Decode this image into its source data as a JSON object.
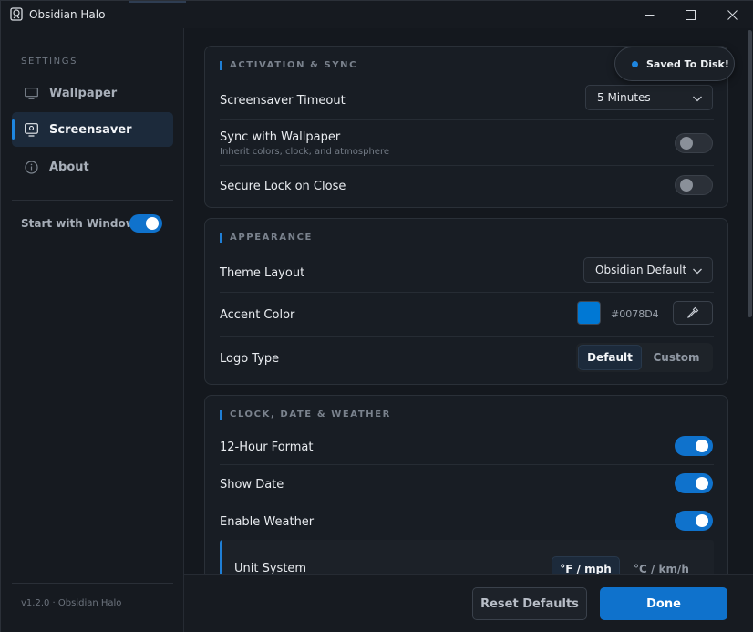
{
  "window": {
    "title": "Obsidian Halo",
    "controls": {
      "minimize": "minimize-icon",
      "maximize": "maximize-icon",
      "close": "close-icon"
    }
  },
  "sidebar": {
    "heading": "SETTINGS",
    "items": [
      {
        "label": "Wallpaper",
        "icon": "monitor-icon",
        "active": false
      },
      {
        "label": "Screensaver",
        "icon": "screensaver-icon",
        "active": true
      },
      {
        "label": "About",
        "icon": "info-icon",
        "active": false
      }
    ],
    "start_with_windows": {
      "label": "Start with Windows",
      "enabled": true
    },
    "version": "v1.2.0 · Obsidian Halo"
  },
  "toast": {
    "text": "Saved To Disk!"
  },
  "sections": {
    "activation": {
      "title": "ACTIVATION & SYNC",
      "timeout": {
        "label": "Screensaver Timeout",
        "value": "5 Minutes"
      },
      "sync": {
        "label": "Sync with Wallpaper",
        "sub": "Inherit colors, clock, and atmosphere",
        "enabled": false
      },
      "secure": {
        "label": "Secure Lock on Close",
        "enabled": false
      }
    },
    "appearance": {
      "title": "APPEARANCE",
      "theme": {
        "label": "Theme Layout",
        "value": "Obsidian Default"
      },
      "accent": {
        "label": "Accent Color",
        "hex": "#0078D4",
        "color": "#0078d4",
        "picker_icon": "eyedropper-icon"
      },
      "logo": {
        "label": "Logo Type",
        "options": [
          "Default",
          "Custom"
        ],
        "selected": "Default"
      }
    },
    "clock": {
      "title": "CLOCK, DATE & WEATHER",
      "hour12": {
        "label": "12-Hour Format",
        "enabled": true
      },
      "show_date": {
        "label": "Show Date",
        "enabled": true
      },
      "weather": {
        "label": "Enable Weather",
        "enabled": true
      },
      "units": {
        "label": "Unit System",
        "options": [
          "°F / mph",
          "°C / km/h"
        ],
        "selected": "°F / mph"
      }
    }
  },
  "footer": {
    "reset": "Reset Defaults",
    "done": "Done"
  }
}
